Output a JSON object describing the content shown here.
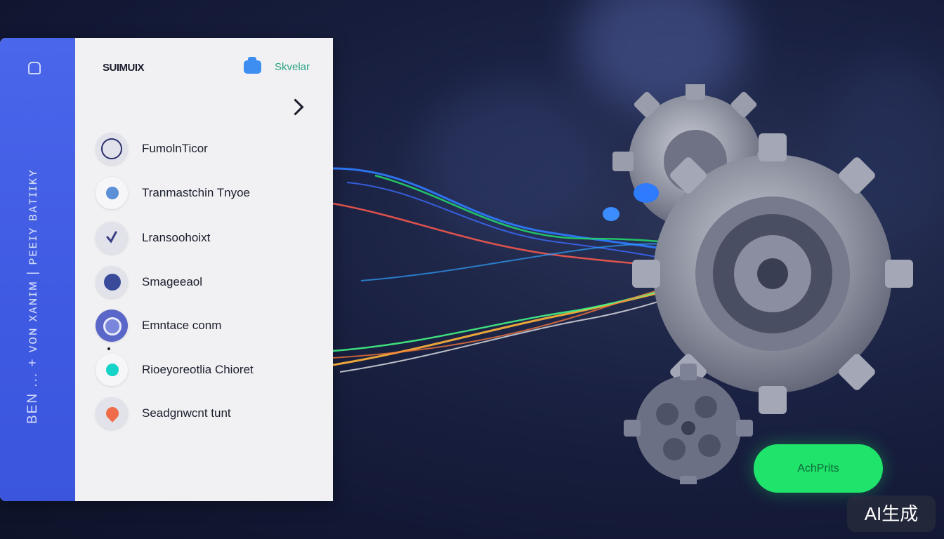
{
  "panel": {
    "brand": "SUIMUIX",
    "sk_label": "Skvelar",
    "rail_text": "BEN ... + ᴠᴏɴ xᴀɴɪᴍ | ᴘᴇᴇɪʏ ʙᴀᴛɪɪᴋʏ",
    "items": [
      {
        "label": "FumolnTicor",
        "color": "#2c2f6e"
      },
      {
        "label": "Tranmastchin Tnyoe",
        "color": "#5b8fd6"
      },
      {
        "label": "Lransoohoixt",
        "color": "#3a3f86"
      },
      {
        "label": "Smageeaol",
        "color": "#3a4a9a"
      },
      {
        "label": "Emntace conm",
        "color": "#5a66c8"
      },
      {
        "label": "Rioeyoreotlia Chioret",
        "color": "#16d3c9"
      },
      {
        "label": "Seadgnwcnt tunt",
        "color": "#ef6b4a"
      }
    ]
  },
  "action": {
    "label": "AchPrits",
    "color": "#1fe36a"
  },
  "watermark": "AI生成"
}
